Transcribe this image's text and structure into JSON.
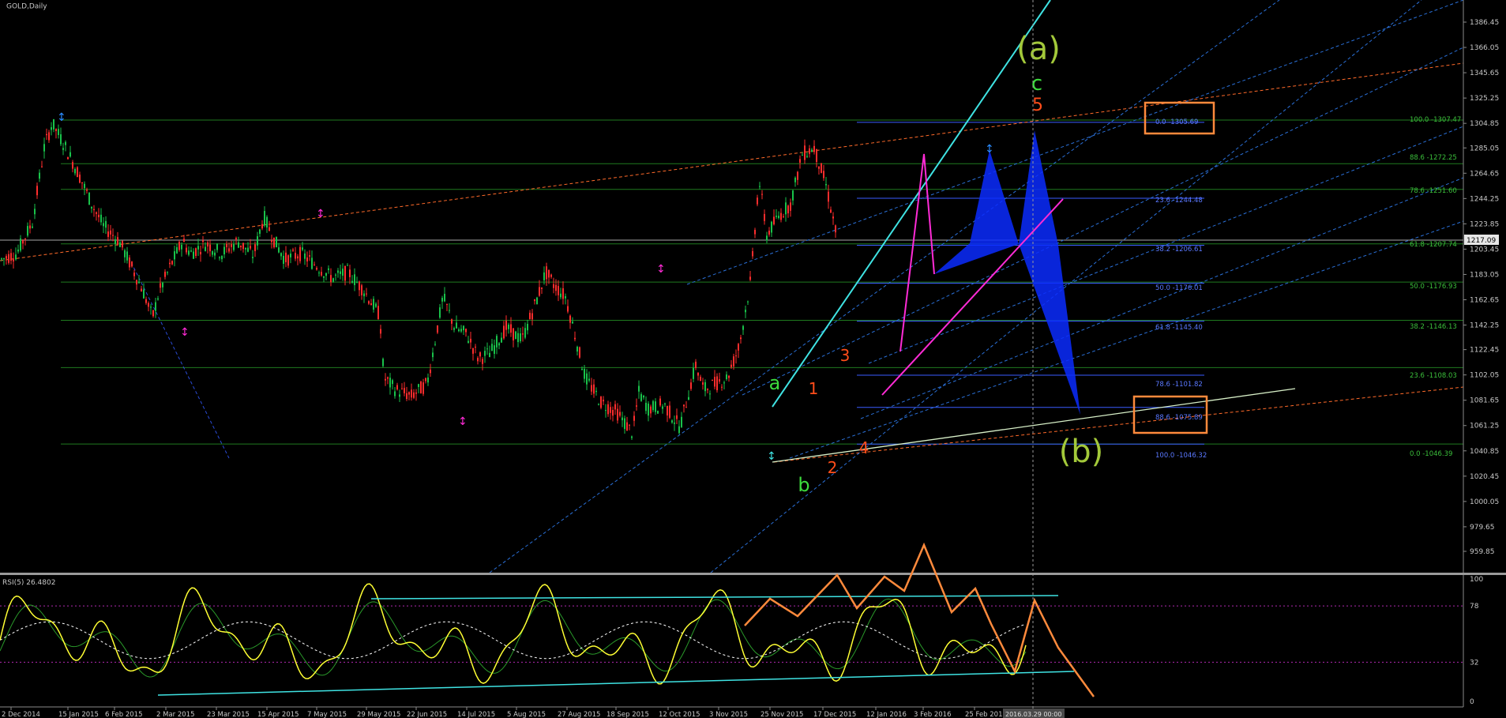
{
  "chart_data": {
    "type": "candlestick",
    "title": "GOLD,Daily",
    "price_axis": {
      "ylim": [
        950,
        1400
      ],
      "ticks": [
        "1386.45",
        "1366.05",
        "1345.65",
        "1325.25",
        "1304.85",
        "1285.05",
        "1264.65",
        "1244.25",
        "1223.85",
        "1203.45",
        "1183.05",
        "1162.65",
        "1142.25",
        "1122.45",
        "1102.05",
        "1081.65",
        "1061.25",
        "1040.85",
        "1020.45",
        "1000.05",
        "979.65",
        "959.85"
      ],
      "current_price": "1217.09"
    },
    "x_axis": {
      "labels": [
        "2 Dec 2014",
        "15 Jan 2015",
        "6 Feb 2015",
        "2 Mar 2015",
        "23 Mar 2015",
        "15 Apr 2015",
        "7 May 2015",
        "29 May 2015",
        "22 Jun 2015",
        "14 Jul 2015",
        "5 Aug 2015",
        "27 Aug 2015",
        "18 Sep 2015",
        "12 Oct 2015",
        "3 Nov 2015",
        "25 Nov 2015",
        "17 Dec 2015",
        "12 Jan 2016",
        "3 Feb 2016",
        "25 Feb 2016"
      ],
      "cursor_label": "2016.03.29 00:00"
    },
    "price_path": [
      [
        0,
        1195
      ],
      [
        20,
        1200
      ],
      [
        40,
        1225
      ],
      [
        55,
        1285
      ],
      [
        65,
        1305
      ],
      [
        80,
        1288
      ],
      [
        100,
        1262
      ],
      [
        115,
        1240
      ],
      [
        130,
        1222
      ],
      [
        150,
        1210
      ],
      [
        165,
        1190
      ],
      [
        180,
        1170
      ],
      [
        192,
        1148
      ],
      [
        200,
        1168
      ],
      [
        215,
        1190
      ],
      [
        230,
        1210
      ],
      [
        240,
        1200
      ],
      [
        260,
        1208
      ],
      [
        280,
        1200
      ],
      [
        300,
        1210
      ],
      [
        320,
        1198
      ],
      [
        333,
        1230
      ],
      [
        345,
        1212
      ],
      [
        360,
        1195
      ],
      [
        380,
        1200
      ],
      [
        400,
        1190
      ],
      [
        420,
        1180
      ],
      [
        440,
        1185
      ],
      [
        460,
        1170
      ],
      [
        480,
        1150
      ],
      [
        485,
        1100
      ],
      [
        500,
        1090
      ],
      [
        520,
        1085
      ],
      [
        540,
        1095
      ],
      [
        560,
        1165
      ],
      [
        575,
        1140
      ],
      [
        590,
        1135
      ],
      [
        605,
        1115
      ],
      [
        620,
        1120
      ],
      [
        640,
        1140
      ],
      [
        660,
        1130
      ],
      [
        680,
        1165
      ],
      [
        690,
        1185
      ],
      [
        700,
        1175
      ],
      [
        715,
        1165
      ],
      [
        725,
        1140
      ],
      [
        740,
        1100
      ],
      [
        760,
        1080
      ],
      [
        780,
        1072
      ],
      [
        800,
        1055
      ],
      [
        808,
        1088
      ],
      [
        820,
        1075
      ],
      [
        840,
        1078
      ],
      [
        860,
        1060
      ],
      [
        880,
        1110
      ],
      [
        890,
        1090
      ],
      [
        905,
        1095
      ],
      [
        920,
        1100
      ],
      [
        935,
        1125
      ],
      [
        950,
        1180
      ],
      [
        960,
        1260
      ],
      [
        970,
        1215
      ],
      [
        985,
        1230
      ],
      [
        1000,
        1240
      ],
      [
        1015,
        1280
      ],
      [
        1030,
        1285
      ],
      [
        1045,
        1255
      ],
      [
        1058,
        1215
      ]
    ],
    "annotations": {
      "big_a": "(a)",
      "big_b": "(b)",
      "wave_c": "c",
      "wave_5": "5",
      "wave_a": "a",
      "wave_b": "b",
      "wave_1": "1",
      "wave_2": "2",
      "wave_3": "3",
      "wave_4": "4"
    },
    "fib_left": [
      "100.0 -1307.47",
      "88.6 -1272.25",
      "78.6 -1251.60",
      "61.8 -1207.74",
      "50.0 -1176.93",
      "38.2 -1146.13",
      "23.6 -1108.03",
      "0.0 -1046.39"
    ],
    "fib_right": [
      "0.0 -1305.69",
      "23.6 -1244.48",
      "38.2 -1206.61",
      "50.0 -1176.01",
      "61.8 -1145.40",
      "78.6 -1101.82",
      "88.6 -1075.89",
      "100.0 -1046.32"
    ],
    "rsi": {
      "label": "RSI(5) 26.4802",
      "ticks": [
        "100",
        "78",
        "32",
        "0"
      ],
      "ylim": [
        0,
        100
      ]
    },
    "colors": {
      "bull": "#19c24a",
      "bear": "#ff2d2d",
      "grid_green": "#1f7a1f",
      "fib_blue": "#3a5cff",
      "pattern": "#0a2bff",
      "magenta": "#ff2bd6",
      "cyan": "#3fe3e3",
      "orange": "#ff8a3c",
      "rsi": "#ffff33",
      "wave_green": "#3ddc3d",
      "wave_orange": "#ff4d1a",
      "big_wave": "#a3c93a"
    }
  }
}
